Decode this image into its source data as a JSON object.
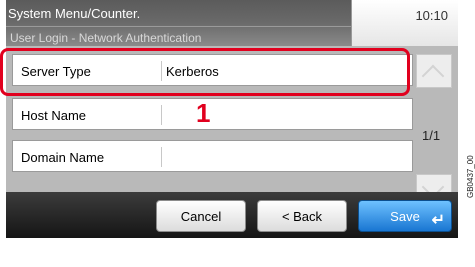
{
  "header": {
    "title": "System Menu/Counter.",
    "subtitle": "User Login - Network Authentication",
    "clock": "10:10"
  },
  "rows": [
    {
      "label": "Server Type",
      "value": "Kerberos"
    },
    {
      "label": "Host Name",
      "value": ""
    },
    {
      "label": "Domain Name",
      "value": ""
    }
  ],
  "page_indicator": "1/1",
  "annotation": {
    "callout": "1",
    "highlight_color": "#e1001e"
  },
  "buttons": {
    "cancel": "Cancel",
    "back": "< Back",
    "save": "Save"
  },
  "image_code": "GB0437_00",
  "colors": {
    "save_button": "#1976d2",
    "highlight": "#e1001e"
  }
}
